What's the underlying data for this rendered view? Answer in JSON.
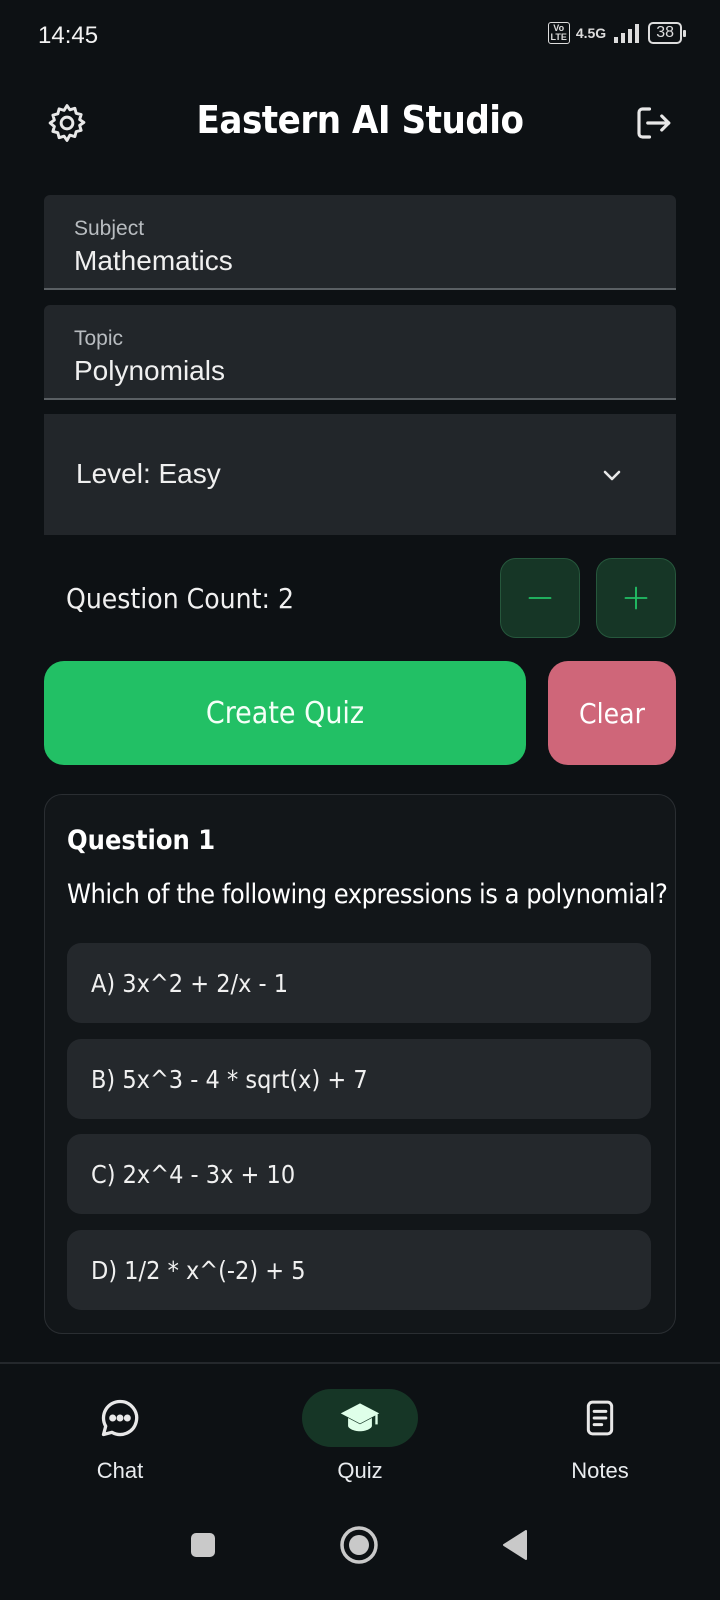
{
  "status": {
    "time": "14:45",
    "volte": "Vo LTE",
    "network": "4.5G",
    "battery": "38"
  },
  "header": {
    "title": "Eastern AI Studio"
  },
  "form": {
    "subject_label": "Subject",
    "subject_value": "Mathematics",
    "topic_label": "Topic",
    "topic_value": "Polynomials",
    "level": "Level: Easy",
    "question_count": "Question Count: 2",
    "create_label": "Create Quiz",
    "clear_label": "Clear"
  },
  "question": {
    "number": "Question 1",
    "text": "Which of the following expressions is a polynomial?",
    "options": [
      "A) 3x^2 + 2/x - 1",
      "B) 5x^3 - 4 * sqrt(x) + 7",
      "C) 2x^4 - 3x + 10",
      "D) 1/2 * x^(-2) + 5"
    ]
  },
  "nav": {
    "chat": "Chat",
    "quiz": "Quiz",
    "notes": "Notes",
    "active": "quiz"
  },
  "colors": {
    "accent": "#22c065",
    "clear": "#cf6679",
    "background": "#0d1114",
    "surface": "#22262a"
  }
}
